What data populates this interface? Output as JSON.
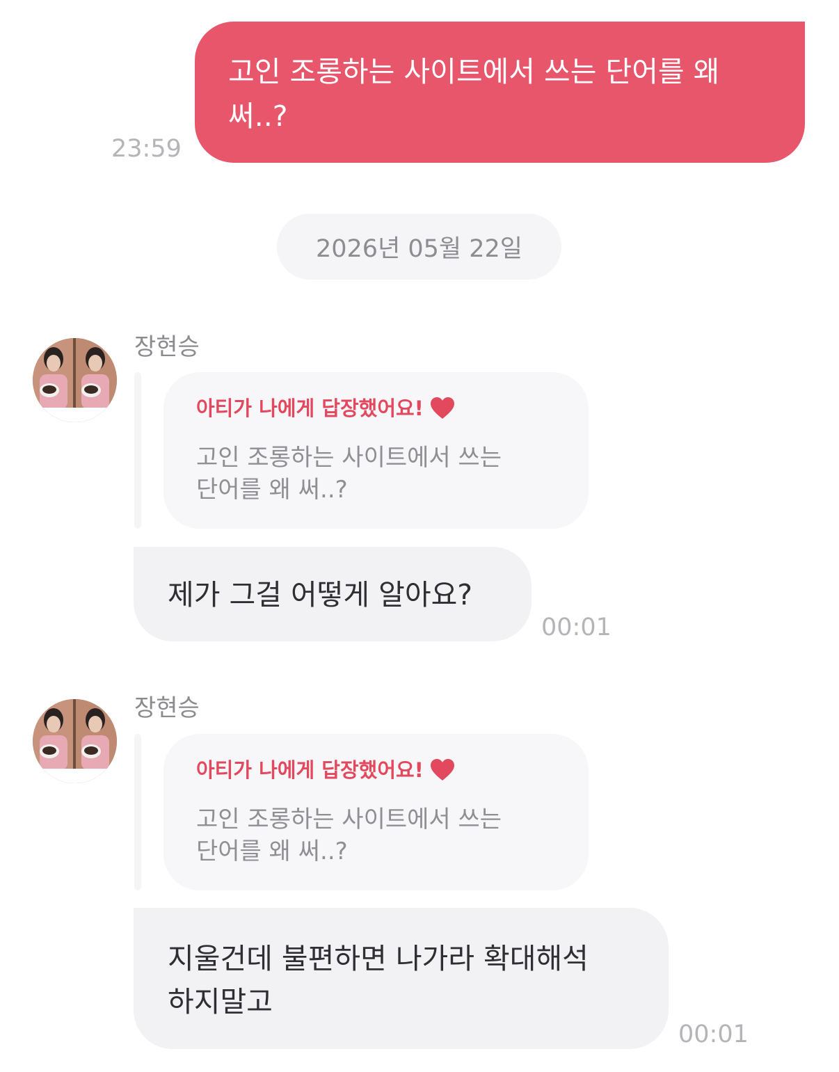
{
  "colors": {
    "sent_bubble": "#e7566b",
    "received_bubble": "#f2f2f5",
    "quote_accent": "#e2485e",
    "timestamp": "#b4b4b9",
    "background": "#ffffff"
  },
  "sent_message": {
    "text": "고인 조롱하는 사이트에서 쓰는 단어를 왜 써..?",
    "time": "23:59"
  },
  "date_divider": "2026년 05월 22일",
  "received_messages": [
    {
      "sender": "장현승",
      "avatar_icon": "profile-photo",
      "reply_quote": {
        "title": "아티가 나에게 답장했어요!",
        "icon": "heart-icon",
        "text": "고인 조롱하는 사이트에서 쓰는 단어를 왜 써..?"
      },
      "text": "제가 그걸 어떻게 알아요?",
      "time": "00:01"
    },
    {
      "sender": "장현승",
      "avatar_icon": "profile-photo",
      "reply_quote": {
        "title": "아티가 나에게 답장했어요!",
        "icon": "heart-icon",
        "text": "고인 조롱하는 사이트에서 쓰는 단어를 왜 써..?"
      },
      "text": "지울건데 불편하면 나가라 확대해석 하지말고",
      "time": "00:01"
    }
  ]
}
